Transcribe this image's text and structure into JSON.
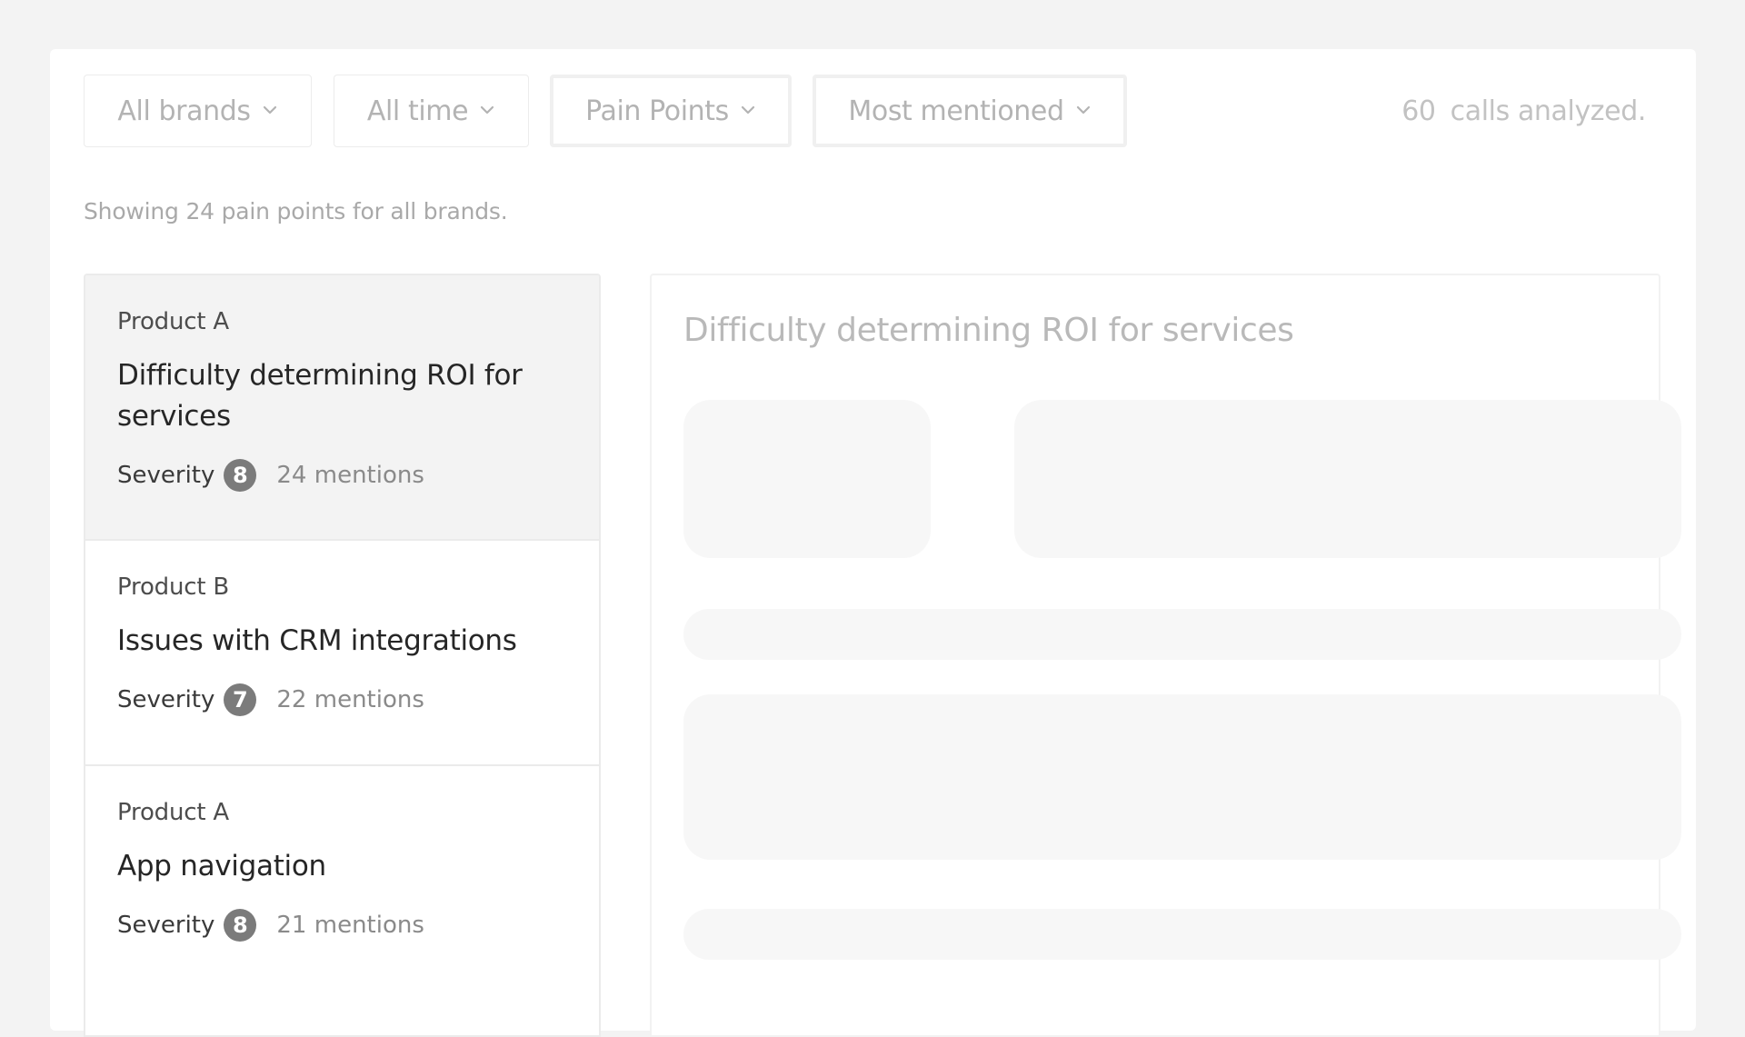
{
  "filters": {
    "brand": "All brands",
    "time": "All time",
    "category": "Pain Points",
    "sort": "Most mentioned"
  },
  "stats": {
    "calls_count": "60",
    "calls_label": "calls analyzed."
  },
  "subtitle": "Showing 24 pain points for all brands.",
  "pain_points": [
    {
      "brand": "Product A",
      "title": "Difficulty determining ROI for services",
      "severity_label": "Severity",
      "severity": "8",
      "mentions": "24 mentions"
    },
    {
      "brand": "Product B",
      "title": "Issues with CRM integrations",
      "severity_label": "Severity",
      "severity": "7",
      "mentions": "22 mentions"
    },
    {
      "brand": "Product A",
      "title": "App navigation",
      "severity_label": "Severity",
      "severity": "8",
      "mentions": "21 mentions"
    }
  ],
  "detail": {
    "title": "Difficulty determining ROI for services"
  },
  "icons": {
    "dropdown": "chevron-down-icon"
  },
  "colors": {
    "badge": "#7b7b7b",
    "selected_bg": "#f3f3f3",
    "page_bg": "#f3f3f3"
  }
}
